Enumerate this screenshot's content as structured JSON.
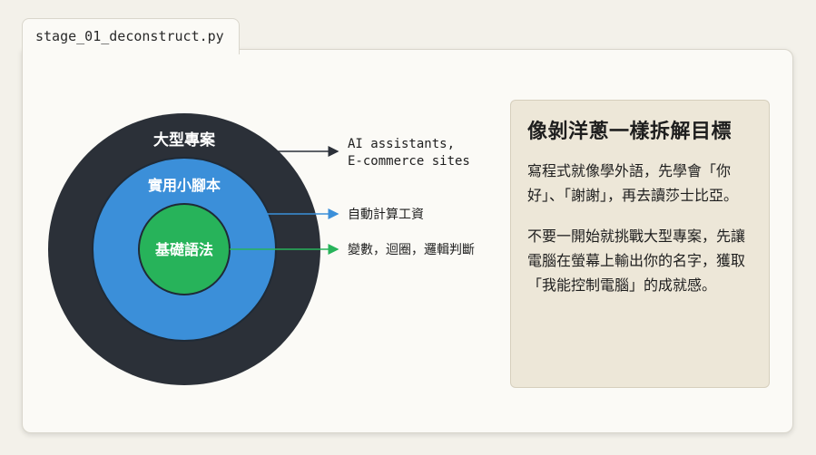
{
  "tab": {
    "filename": "stage_01_deconstruct.py"
  },
  "diagram": {
    "layers": [
      {
        "label": "大型專案",
        "color": "#2b3038",
        "annotation": [
          "AI assistants,",
          "E-commerce sites"
        ]
      },
      {
        "label": "實用小腳本",
        "color": "#3b8fd9",
        "annotation": [
          "自動計算工資"
        ]
      },
      {
        "label": "基礎語法",
        "color": "#27b35a",
        "annotation": [
          "變數，迴圈，邏輯判斷"
        ]
      }
    ],
    "line_colors": [
      "#2b3038",
      "#3b8fd9",
      "#27b35a"
    ]
  },
  "panel": {
    "title": "像剝洋蔥一樣拆解目標",
    "paragraph1": "寫程式就像學外語，先學會「你好」、「謝謝」，再去讀莎士比亞。",
    "paragraph2": "不要一開始就挑戰大型專案，先讓電腦在螢幕上輸出你的名字，獲取「我能控制電腦」的成就感。"
  }
}
